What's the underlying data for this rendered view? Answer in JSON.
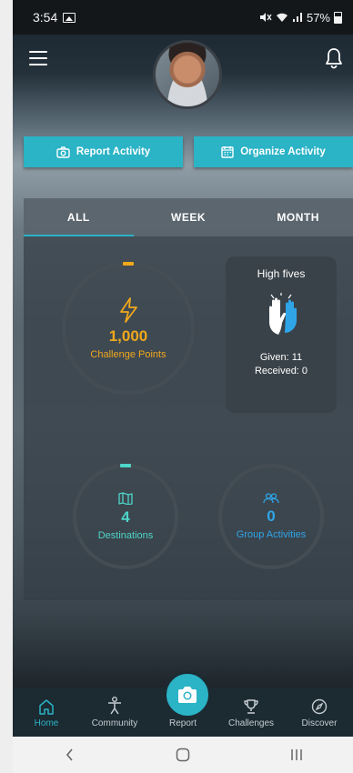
{
  "status_bar": {
    "time": "3:54",
    "right_text": "ℕ︎ ︎",
    "battery_text": "57%"
  },
  "header": {
    "menu_icon": "hamburger-icon",
    "notification_icon": "bell-icon",
    "avatar": "profile-photo"
  },
  "actions": {
    "report_label": "Report Activity",
    "organize_label": "Organize Activity"
  },
  "tabs": [
    {
      "label": "ALL",
      "active": true
    },
    {
      "label": "WEEK",
      "active": false
    },
    {
      "label": "MONTH",
      "active": false
    }
  ],
  "stats": {
    "challenge_points": {
      "value": "1,000",
      "label": "Challenge Points",
      "color": "#f0a81c",
      "icon": "lightning-icon"
    },
    "destinations": {
      "value": "4",
      "label": "Destinations",
      "color": "#4ed5c8",
      "icon": "map-icon"
    },
    "group_activities": {
      "value": "0",
      "label": "Group Activities",
      "color": "#2fa5e8",
      "icon": "group-icon"
    }
  },
  "high_fives": {
    "title": "High fives",
    "given": "Given: 11",
    "received": "Received: 0"
  },
  "bottom_nav": [
    {
      "label": "Home",
      "icon": "home-icon",
      "active": true
    },
    {
      "label": "Community",
      "icon": "person-icon",
      "active": false
    },
    {
      "label": "Report",
      "icon": "camera-icon",
      "active": false
    },
    {
      "label": "Challenges",
      "icon": "trophy-icon",
      "active": false
    },
    {
      "label": "Discover",
      "icon": "compass-icon",
      "active": false
    }
  ],
  "system_nav": {
    "back": "‹",
    "home": "○",
    "recents": "|||"
  },
  "colors": {
    "accent": "#2bb3c6",
    "nav_bg": "#1c2a32"
  }
}
